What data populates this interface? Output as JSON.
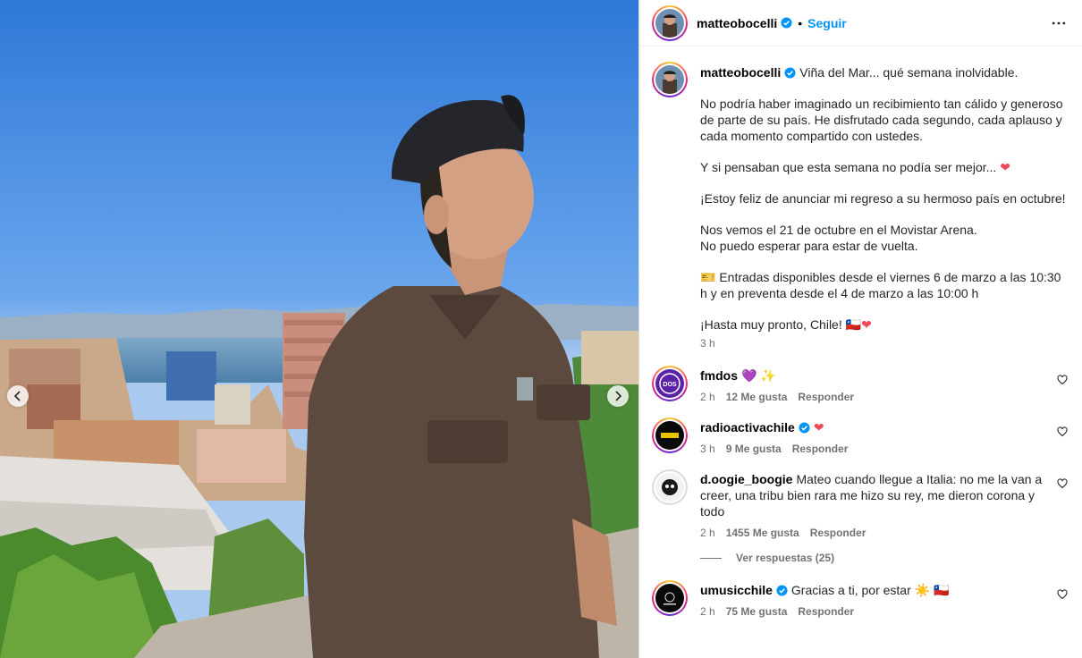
{
  "post": {
    "author": "matteobocelli",
    "follow_label": "Seguir",
    "dot": "•",
    "caption_lines": [
      "Viña del Mar... qué semana inolvidable.",
      "No podría haber imaginado un recibimiento tan cálido y generoso de parte de su país. He disfrutado cada segundo, cada aplauso y cada momento compartido con ustedes.",
      "Y si pensaban que esta semana no podía ser mejor... ",
      "¡Estoy feliz de anunciar mi regreso a su hermoso país en octubre!",
      "Nos vemos el 21 de octubre en el Movistar Arena.",
      "No puedo esperar para estar de vuelta.",
      "🎫 Entradas disponibles desde el viernes 6 de marzo a las 10:30 h y en preventa desde el 4 de marzo a las 10:00 h",
      "¡Hasta muy pronto, Chile! ",
      "🇨🇱"
    ],
    "heart": "❤",
    "time": "3 h"
  },
  "comments": [
    {
      "user": "fmdos",
      "text": "💜 ✨",
      "time": "2 h",
      "likes": "12 Me gusta",
      "reply": "Responder",
      "verified": false
    },
    {
      "user": "radioactivachile",
      "text": "❤",
      "time": "3 h",
      "likes": "9 Me gusta",
      "reply": "Responder",
      "verified": true
    },
    {
      "user": "d.oogie_boogie",
      "text": "Mateo cuando llegue a Italia: no me la van a creer, una tribu bien rara me hizo su rey, me dieron corona y todo",
      "time": "2 h",
      "likes": "1455 Me gusta",
      "reply": "Responder",
      "verified": false
    },
    {
      "user": "umusicchile",
      "text": "Gracias a ti, por estar ☀️ 🇨🇱",
      "time": "2 h",
      "likes": "75 Me gusta",
      "reply": "Responder",
      "verified": true
    }
  ],
  "view_replies": "Ver respuestas (25)",
  "avatar_labels": {
    "fmdos": "DOS"
  },
  "icons": {
    "more": "more-options-icon",
    "verified": "verified-badge-icon",
    "like": "heart-outline-icon",
    "prev": "chevron-left-icon",
    "next": "chevron-right-icon"
  },
  "colors": {
    "accent": "#0095f6",
    "verified": "#0095f6",
    "heart": "#ed4956",
    "muted": "#737373"
  }
}
